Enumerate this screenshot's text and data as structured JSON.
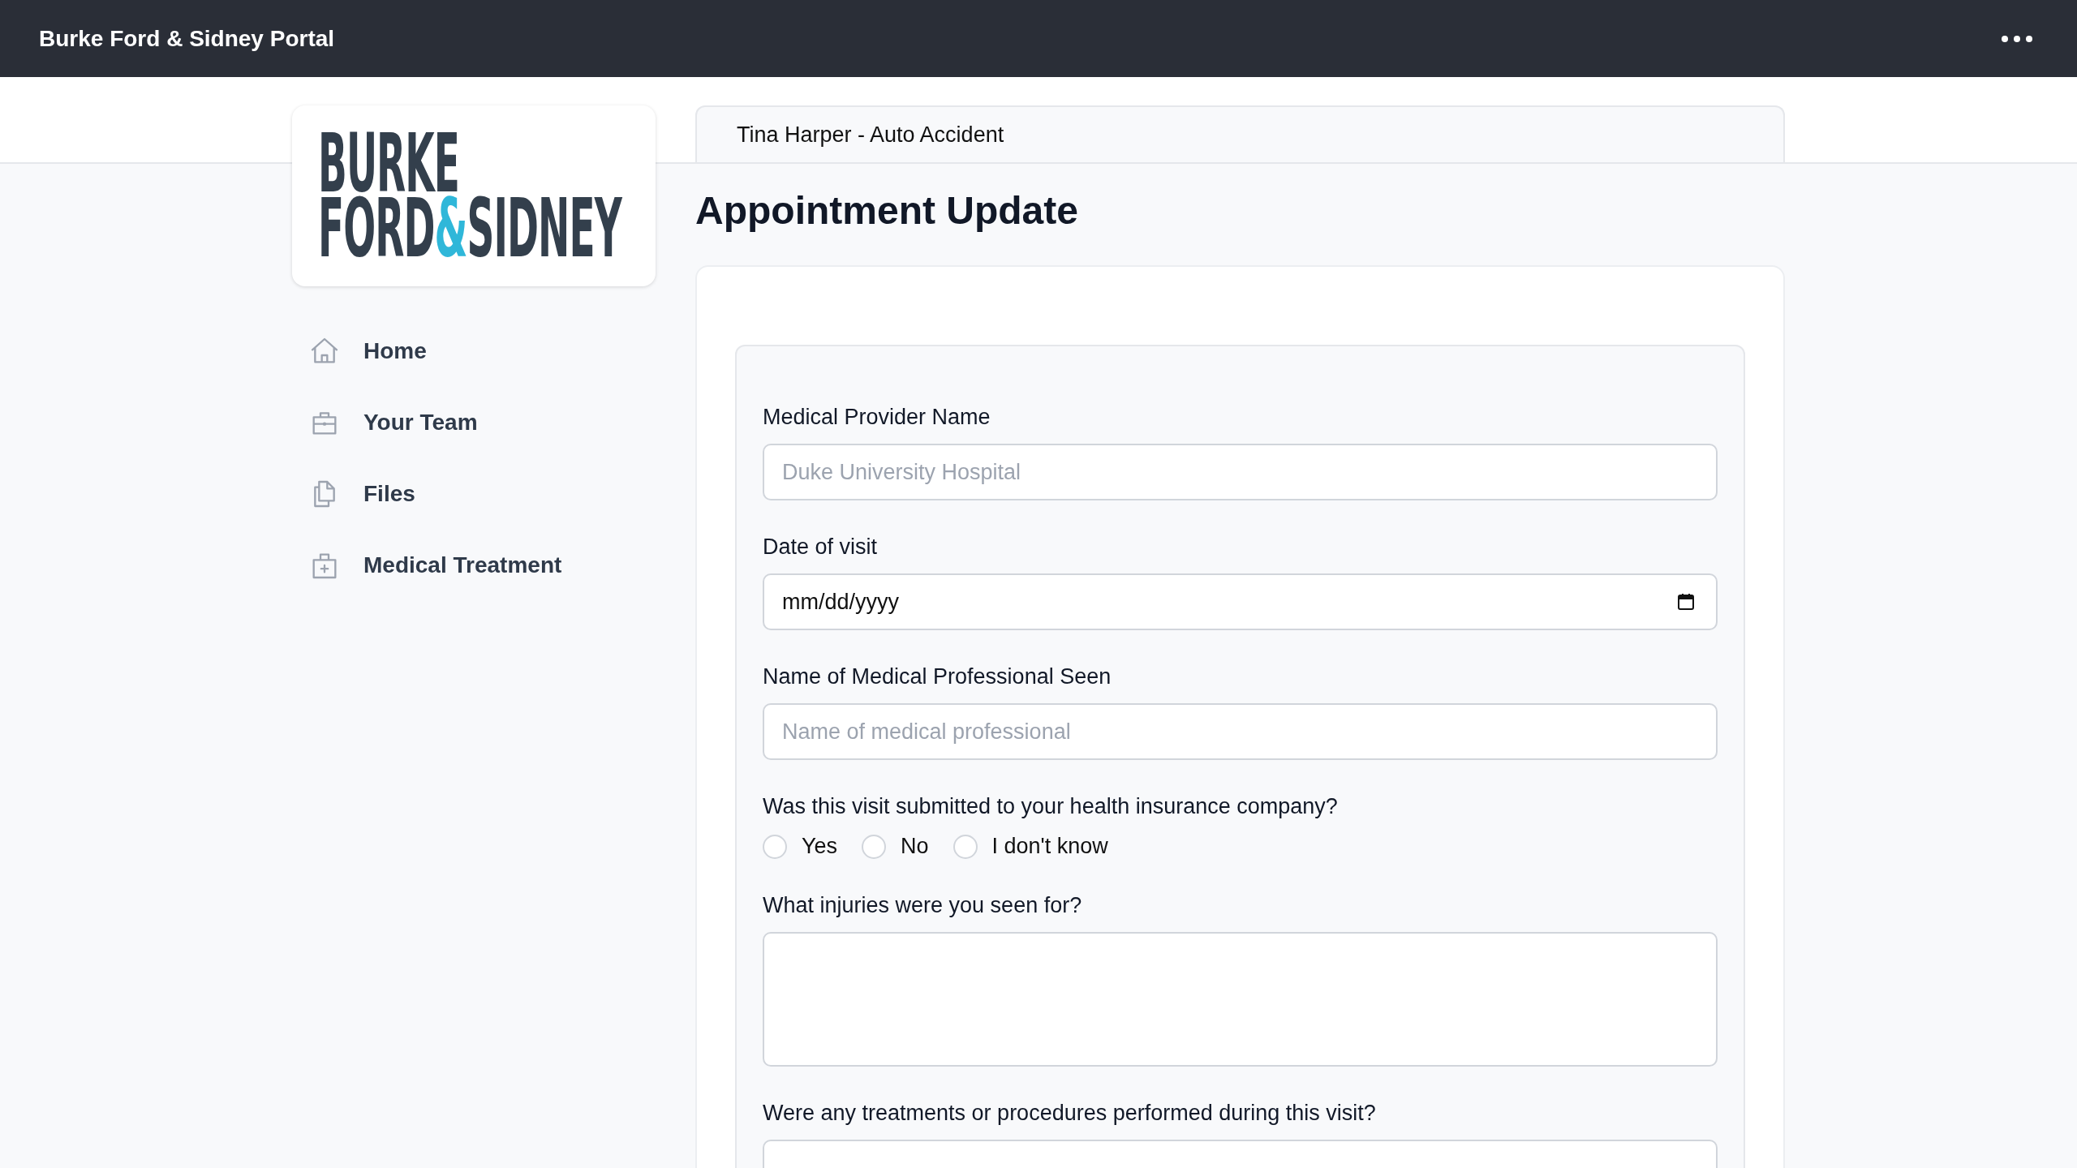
{
  "top_bar": {
    "title": "Burke Ford & Sidney Portal"
  },
  "logo": {
    "line_1": "BURKE",
    "line_2": [
      {
        "text": "FORD",
        "accent": false
      },
      {
        "text": "&",
        "accent": true
      },
      {
        "text": "SIDNEY",
        "accent": false
      }
    ]
  },
  "sidebar": {
    "items": [
      {
        "label": "Home",
        "kind": "home"
      },
      {
        "label": "Your Team",
        "kind": "team"
      },
      {
        "label": "Files",
        "kind": "files"
      },
      {
        "label": "Medical Treatment",
        "kind": "medical"
      }
    ]
  },
  "case_tab": {
    "label": "Tina Harper - Auto Accident"
  },
  "page_title": "Appointment Update",
  "form": {
    "fields": [
      {
        "kind": "text",
        "label": "Medical Provider Name",
        "placeholder": "Duke University Hospital"
      },
      {
        "kind": "date",
        "label": "Date of visit",
        "placeholder": "mm/dd/yyyy"
      },
      {
        "kind": "text",
        "label": "Name of Medical Professional Seen",
        "placeholder": "Name of medical professional"
      },
      {
        "kind": "radio",
        "label": "Was this visit submitted to your health insurance company?",
        "options": [
          {
            "label": "Yes",
            "selected": false
          },
          {
            "label": "No",
            "selected": false
          },
          {
            "label": "I don't know",
            "selected": false
          }
        ]
      },
      {
        "kind": "textarea",
        "label": "What injuries were you seen for?"
      },
      {
        "kind": "text",
        "label": "Were any treatments or procedures performed during this visit?"
      }
    ]
  }
}
